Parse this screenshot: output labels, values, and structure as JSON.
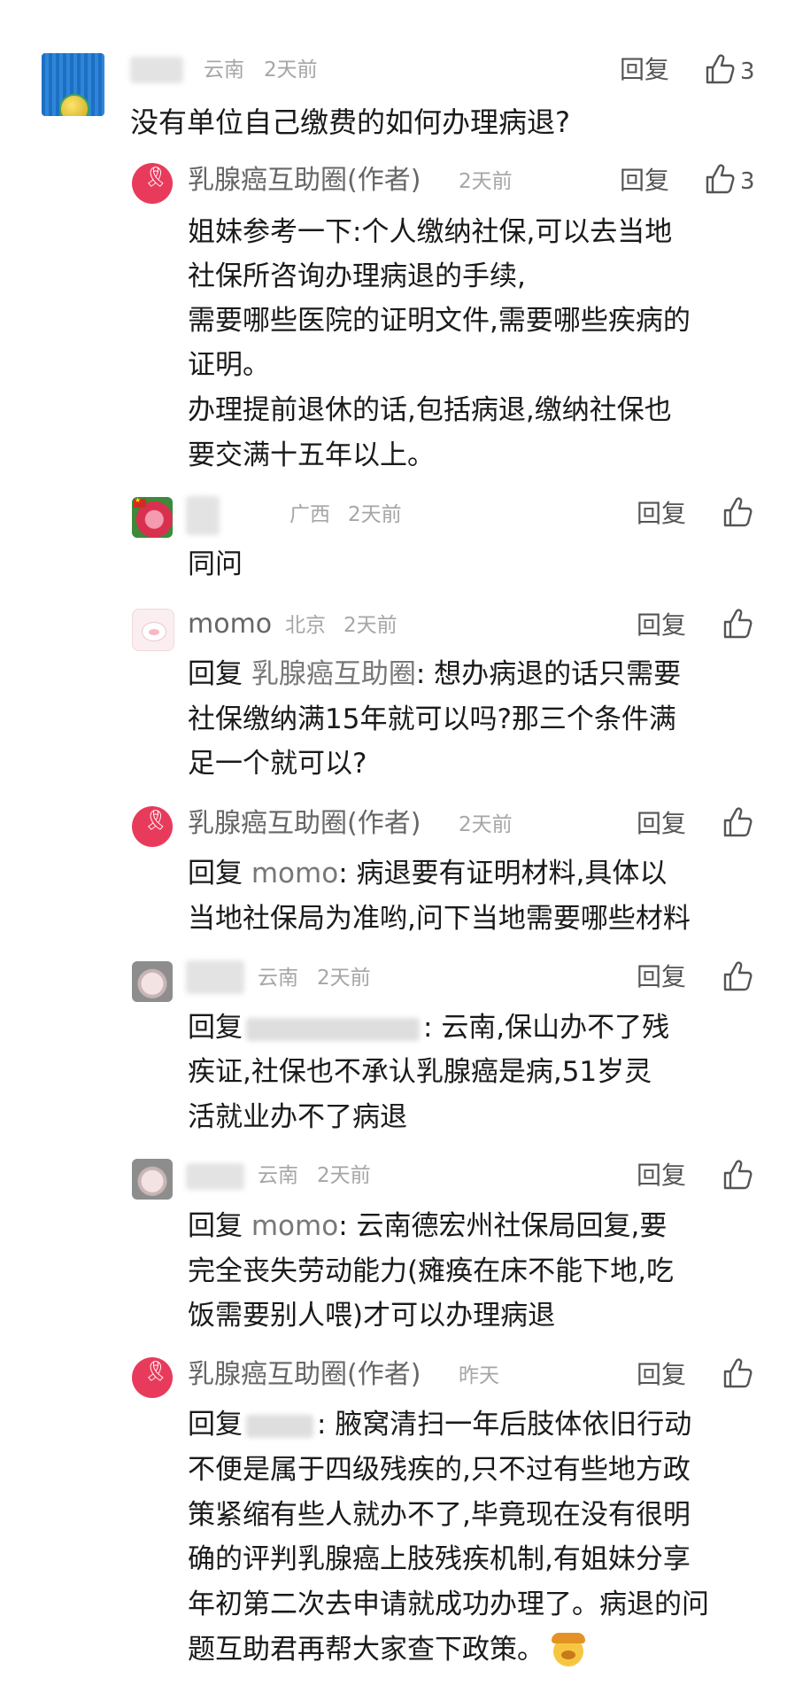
{
  "comments": [
    {
      "user_name": "",
      "location": "云南",
      "time": "2天前",
      "reply": "回复",
      "likes": "3",
      "lines": [
        "没有单位自己缴费的如何办理病退?"
      ]
    },
    {
      "user_name": "乳腺癌互助圈(作者)",
      "location": "",
      "time": "2天前",
      "reply": "回复",
      "likes": "3",
      "lines": [
        "姐妹参考一下:个人缴纳社保,可以去当地",
        "社保所咨询办理病退的手续,",
        "需要哪些医院的证明文件,需要哪些疾病的",
        "证明。",
        "办理提前退休的话,包括病退,缴纳社保也",
        "要交满十五年以上。"
      ]
    },
    {
      "user_name": "",
      "location": "广西",
      "time": "2天前",
      "reply": "回复",
      "lines": [
        "同问"
      ]
    },
    {
      "user_name": "momo",
      "location": "北京",
      "time": "2天前",
      "reply": "回复",
      "reply_prefix": "回复",
      "reply_target": "乳腺癌互助圈",
      "lines": [
        "想办病退的话只需要",
        "社保缴纳满15年就可以吗?那三个条件满",
        "足一个就可以?"
      ]
    },
    {
      "user_name": "乳腺癌互助圈(作者)",
      "location": "",
      "time": "2天前",
      "reply": "回复",
      "reply_prefix": "回复",
      "reply_target": "momo",
      "lines": [
        "病退要有证明材料,具体以",
        "当地社保局为准哟,问下当地需要哪些材料"
      ]
    },
    {
      "user_name": "",
      "location": "云南",
      "time": "2天前",
      "reply": "回复",
      "reply_prefix": "回复",
      "lines": [
        "云南,保山办不了残",
        "疾证,社保也不承认乳腺癌是病,51岁灵",
        "活就业办不了病退"
      ]
    },
    {
      "user_name": "",
      "location": "云南",
      "time": "2天前",
      "reply": "回复",
      "reply_prefix": "回复",
      "reply_target": "momo",
      "lines": [
        "云南德宏州社保局回复,要",
        "完全丧失劳动能力(瘫痪在床不能下地,吃",
        "饭需要别人喂)才可以办理病退"
      ]
    },
    {
      "user_name": "乳腺癌互助圈(作者)",
      "location": "",
      "time": "昨天",
      "reply": "回复",
      "reply_prefix": "回复",
      "lines": [
        "腋窝清扫一年后肢体依旧行动",
        "不便是属于四级残疾的,只不过有些地方政",
        "策紧缩有些人就办不了,毕竟现在没有很明",
        "确的评判乳腺癌上肢残疾机制,有姐妹分享",
        "年初第二次去申请就成功办理了。病退的问",
        "题互助君再帮大家查下政策。"
      ]
    }
  ],
  "icons": {
    "like": "thumbs-up-icon",
    "emoji": "thinking-face-emoji"
  }
}
